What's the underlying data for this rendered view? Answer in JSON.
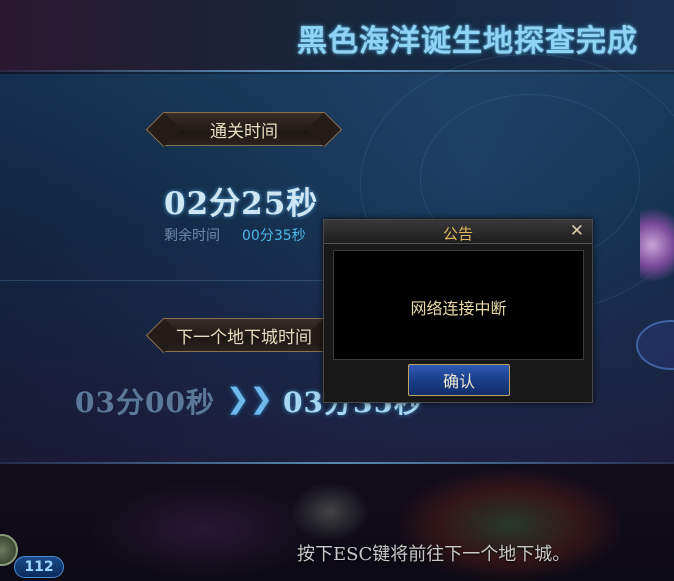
{
  "header": {
    "title": "黑色海洋诞生地探查完成"
  },
  "clear": {
    "banner": "通关时间",
    "time": "02分25秒",
    "remain_label": "剩余时间",
    "remain_value": "00分35秒"
  },
  "next": {
    "banner": "下一个地下城时间",
    "old_time": "03分00秒",
    "arrow": "❯❯",
    "new_time": "03分35秒"
  },
  "footer": {
    "hint": "按下ESC键将前往下一个地下城。"
  },
  "player": {
    "level": "112"
  },
  "dialog": {
    "title": "公告",
    "close": "✕",
    "message": "网络连接中断",
    "confirm": "确认"
  },
  "colors": {
    "title": "#8fd4f4",
    "remain_value": "#4fb6ea",
    "dialog_title": "#e0b860",
    "confirm_button": "#2e5ab4"
  }
}
